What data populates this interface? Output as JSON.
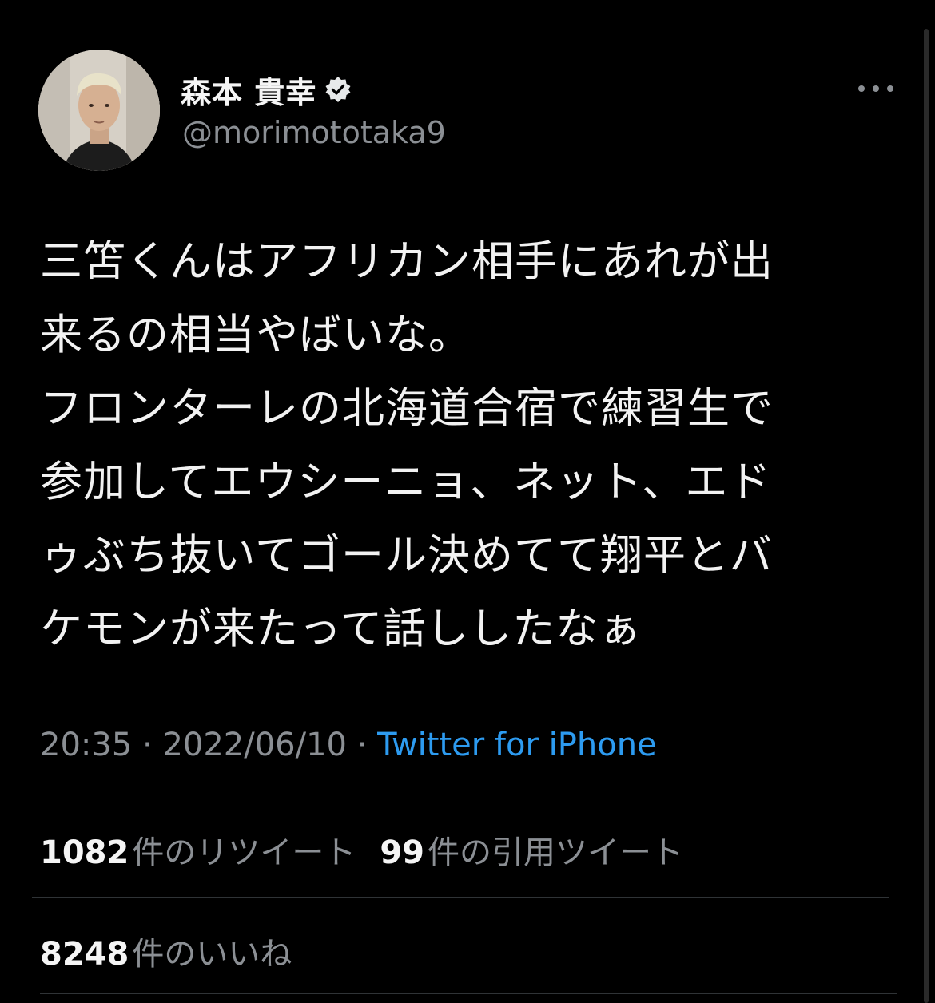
{
  "user": {
    "display_name": "森本 貴幸",
    "handle": "@morimototaka9",
    "verified": true
  },
  "icons": {
    "avatar": "profile-photo",
    "verified": "verified-badge-icon",
    "more": "more-options-icon"
  },
  "tweet": {
    "text": "三笘くんはアフリカン相手にあれが出\n来るの相当やばいな。\nフロンターレの北海道合宿で練習生で\n参加してエウシーニョ、ネット、エド\nゥぶち抜いてゴール決めてて翔平とバ\nケモンが来たって話ししたなぁ"
  },
  "meta": {
    "time": "20:35",
    "separator": "·",
    "date": "2022/06/10",
    "source": "Twitter for iPhone"
  },
  "stats": {
    "retweets_count": "1082",
    "retweets_label": "件のリツイート",
    "quotes_count": "99",
    "quotes_label": "件の引用ツイート",
    "likes_count": "8248",
    "likes_label": "件のいいね"
  },
  "colors": {
    "background": "#000000",
    "text": "#f2f2f2",
    "secondary": "#8b8f94",
    "link": "#2d9bf0",
    "divider": "#2f3336"
  }
}
